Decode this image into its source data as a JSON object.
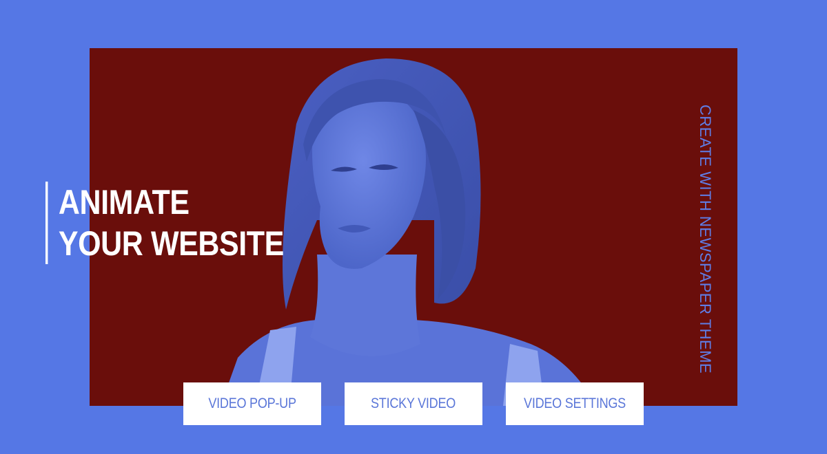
{
  "colors": {
    "page_background": "#5577e5",
    "panel_background": "#6a0e0b",
    "accent_blue": "#5f7ee6",
    "text_white": "#ffffff"
  },
  "headline": {
    "line1": "ANIMATE",
    "line2": "YOUR WEBSITE"
  },
  "tagline": "CREATE WITH NEWSPAPER THEME",
  "buttons": [
    {
      "label": "VIDEO POP-UP"
    },
    {
      "label": "STICKY VIDEO"
    },
    {
      "label": "VIDEO SETTINGS"
    }
  ],
  "media": {
    "subject": "woman-portrait-duotone"
  }
}
